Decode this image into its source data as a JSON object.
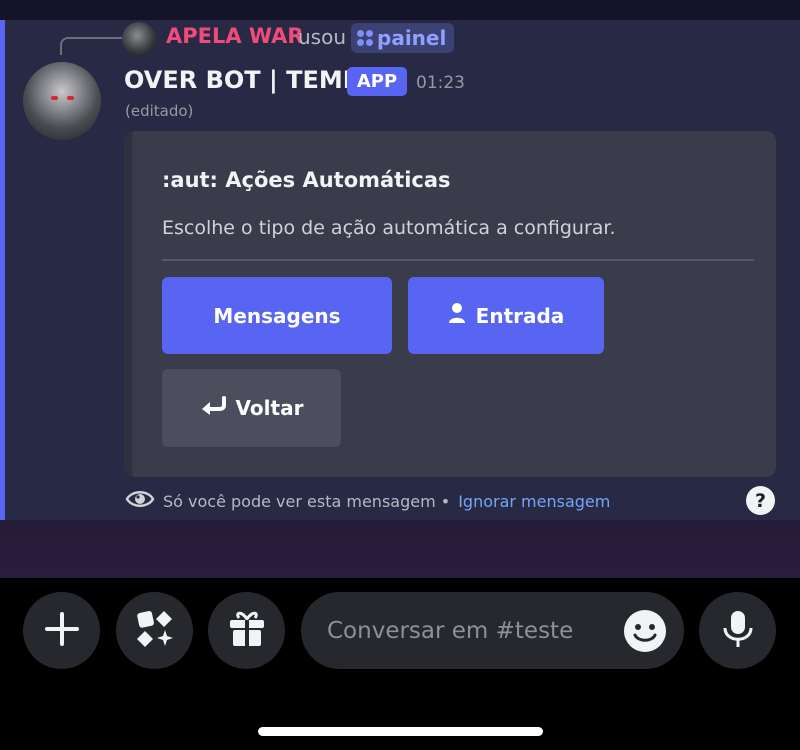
{
  "reply": {
    "user": "APELA WAR",
    "action": "usou",
    "command": "painel"
  },
  "message": {
    "author": "OVER BOT | TEMP",
    "badge": "APP",
    "time": "01:23",
    "edited": "(editado)"
  },
  "embed": {
    "title": ":aut: Ações Automáticas",
    "description": "Escolhe o tipo de ação automática a configurar.",
    "buttons": [
      {
        "label": "Mensagens",
        "style": "primary"
      },
      {
        "label": "Entrada",
        "style": "primary",
        "icon": "user-icon"
      },
      {
        "label": "Voltar",
        "style": "secondary",
        "icon": "return-arrow-icon"
      }
    ]
  },
  "ephemeral": {
    "text": "Só você pode ver esta mensagem •",
    "dismiss": "Ignorar mensagem"
  },
  "composer": {
    "placeholder": "Conversar em #teste"
  },
  "colors": {
    "accent": "#5865f2",
    "reply_name": "#f04b7c",
    "link": "#73a7f5"
  }
}
